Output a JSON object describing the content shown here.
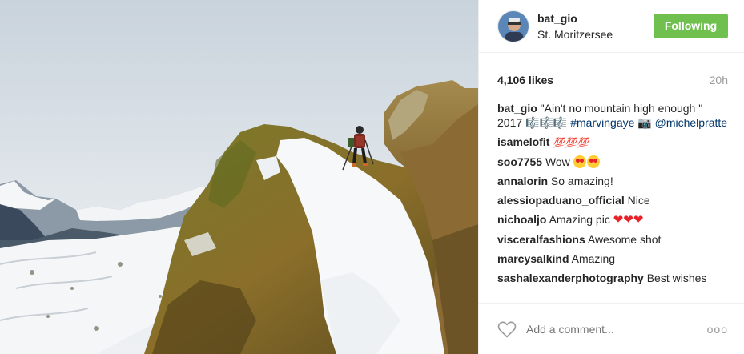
{
  "post": {
    "username": "bat_gio",
    "location": "St. Moritzersee",
    "follow_label": "Following",
    "likes": "4,106 likes",
    "time": "20h",
    "caption": {
      "user": "bat_gio",
      "text": "\"Ain't no mountain high enough \" 2017 🎼🎼🎼",
      "hashtag": "#marvingaye",
      "camera": "📷",
      "mention": "@michelpratte"
    },
    "comments": [
      {
        "user": "isamelofit",
        "text": "💯💯💯",
        "kind": "hundred"
      },
      {
        "user": "soo7755",
        "text": "Wow",
        "kind": "faces"
      },
      {
        "user": "annalorin",
        "text": "So amazing!",
        "kind": "plain"
      },
      {
        "user": "alessiopaduano_official",
        "text": "Nice",
        "kind": "plain"
      },
      {
        "user": "nichoaljo",
        "text": "Amazing pic",
        "kind": "hearts"
      },
      {
        "user": "visceralfashions",
        "text": "Awesome shot",
        "kind": "plain"
      },
      {
        "user": "marcysalkind",
        "text": "Amazing",
        "kind": "plain"
      },
      {
        "user": "sashalexanderphotography",
        "text": "Best wishes",
        "kind": "plain"
      }
    ],
    "add_comment_placeholder": "Add a comment...",
    "more_label": "ooo"
  },
  "colors": {
    "follow_green": "#70c050",
    "link_blue": "#003569",
    "muted_gray": "#999999"
  },
  "icons": {
    "like": "heart-outline-icon",
    "more": "more-options-icon"
  }
}
